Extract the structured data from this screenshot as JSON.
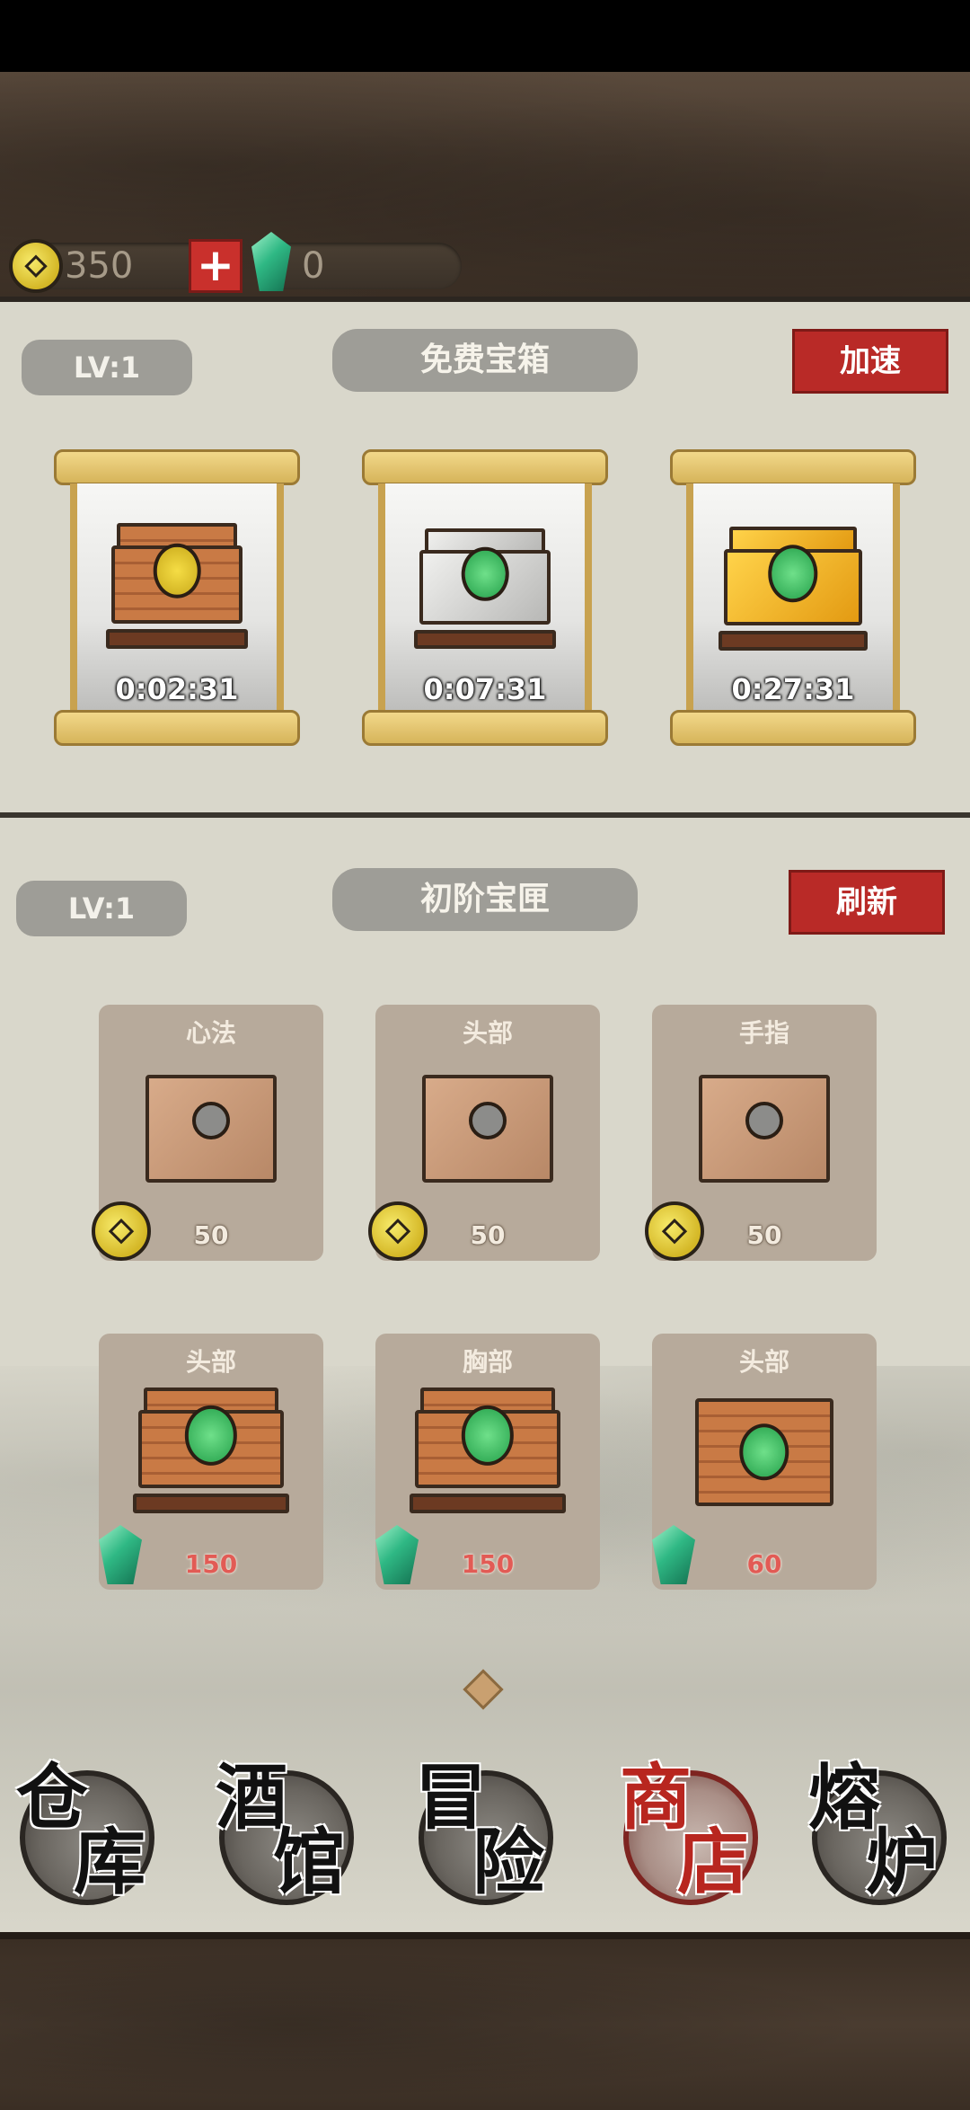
{
  "currency": {
    "coins": "350",
    "gems": "0",
    "coin_icon": "coin-icon",
    "gem_icon": "gem-icon",
    "plus_icon": "plus-icon"
  },
  "free_chests": {
    "level": "LV:1",
    "title": "免费宝箱",
    "speed_button": "加速",
    "chests": [
      {
        "timer": "0:02:31",
        "style": "wood"
      },
      {
        "timer": "0:07:31",
        "style": "silver"
      },
      {
        "timer": "0:27:31",
        "style": "gold"
      }
    ]
  },
  "shop": {
    "level": "LV:1",
    "title": "初阶宝匣",
    "refresh_button": "刷新",
    "items": [
      {
        "name": "心法",
        "price": "50",
        "currency": "coin"
      },
      {
        "name": "头部",
        "price": "50",
        "currency": "coin"
      },
      {
        "name": "手指",
        "price": "50",
        "currency": "coin"
      },
      {
        "name": "头部",
        "price": "150",
        "currency": "gem"
      },
      {
        "name": "胸部",
        "price": "150",
        "currency": "gem"
      },
      {
        "name": "头部",
        "price": "60",
        "currency": "gem"
      }
    ]
  },
  "nav": {
    "items": [
      {
        "c1": "仓",
        "c2": "库"
      },
      {
        "c1": "酒",
        "c2": "馆"
      },
      {
        "c1": "冒",
        "c2": "险"
      },
      {
        "c1": "商",
        "c2": "店"
      },
      {
        "c1": "熔",
        "c2": "炉"
      }
    ],
    "active_index": 3
  },
  "colors": {
    "accent_red": "#b92a27",
    "paper": "#d9d7cb",
    "card": "#b7aa9b",
    "gold": "#f2d88a"
  }
}
